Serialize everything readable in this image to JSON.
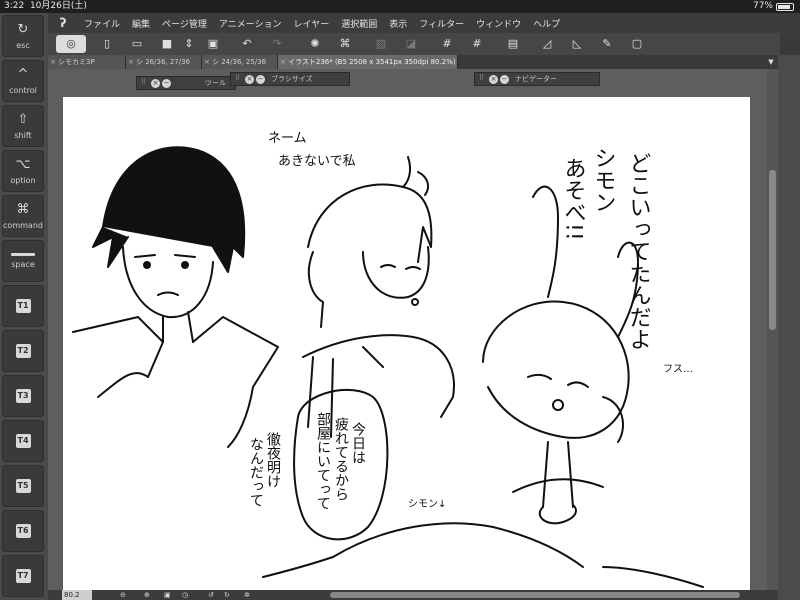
{
  "status_bar": {
    "time": "3:22",
    "date": "10月26日(土)",
    "battery": "77%"
  },
  "left_keys": [
    {
      "icon": "↻",
      "label": "esc",
      "icon_name": "undo-icon"
    },
    {
      "icon": "^",
      "label": "control",
      "icon_name": "caret-icon"
    },
    {
      "icon": "⇧",
      "label": "shift",
      "icon_name": "shift-icon"
    },
    {
      "icon": "⌥",
      "label": "option",
      "icon_name": "option-icon"
    },
    {
      "icon": "⌘",
      "label": "command",
      "icon_name": "command-icon"
    },
    {
      "icon": "",
      "label": "space",
      "icon_name": "space-bar-icon"
    },
    {
      "label": "T1"
    },
    {
      "label": "T2"
    },
    {
      "label": "T3"
    },
    {
      "label": "T4"
    },
    {
      "label": "T5"
    },
    {
      "label": "T6"
    },
    {
      "label": "T7"
    }
  ],
  "menu": [
    "ファイル",
    "編集",
    "ページ管理",
    "アニメーション",
    "レイヤー",
    "選択範囲",
    "表示",
    "フィルター",
    "ウィンドウ",
    "ヘルプ"
  ],
  "tabs": [
    {
      "label": "シモカミ3P"
    },
    {
      "label": "シ 26/36, 27/36"
    },
    {
      "label": "シ 24/36, 25/36"
    },
    {
      "label": "イラスト236* (B5 2508 x 3541px 350dpi 80.2%)"
    }
  ],
  "palettes": {
    "tool": "ツール",
    "brush_size": "ブラシサイズ",
    "navigator": "ナビゲーター"
  },
  "bottom": {
    "zoom": "80.2"
  }
}
